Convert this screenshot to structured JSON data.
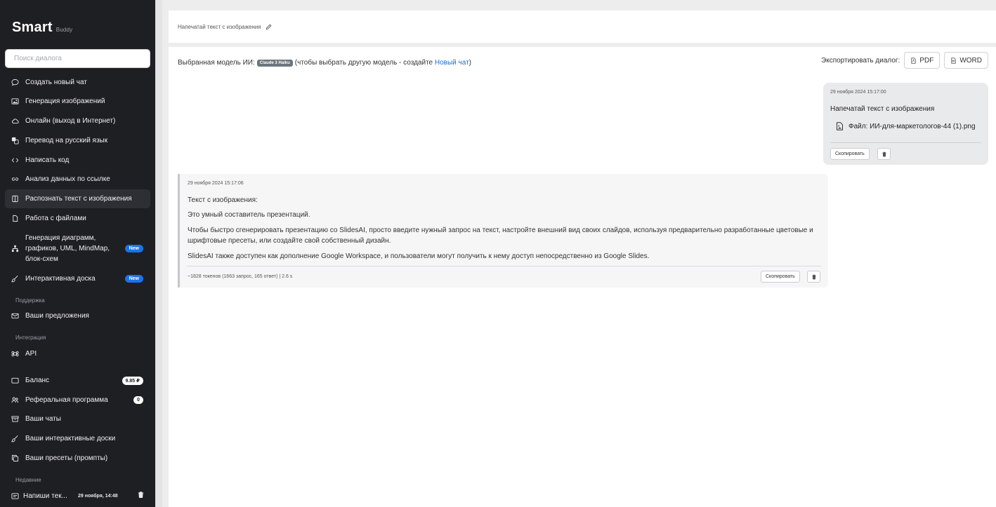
{
  "sidebar": {
    "brand": "Smart",
    "brand_sub": "Buddy",
    "search_placeholder": "Поиск диалога",
    "items": [
      {
        "label": "Создать новый чат",
        "icon": "chat-icon"
      },
      {
        "label": "Генерация изображений",
        "icon": "image-icon"
      },
      {
        "label": "Онлайн (выход в Интернет)",
        "icon": "cloud-icon"
      },
      {
        "label": "Перевод на русский язык",
        "icon": "translate-icon"
      },
      {
        "label": "Написать код",
        "icon": "code-icon"
      },
      {
        "label": "Анализ данных по ссылке",
        "icon": "link-icon"
      },
      {
        "label": "Распознать текст с изображения",
        "icon": "ocr-icon",
        "active": true
      },
      {
        "label": "Работа с файлами",
        "icon": "file-icon"
      },
      {
        "label": "Генерация диаграмм, графиков, UML, MindMap, блок-схем",
        "icon": "diagram-icon",
        "badge": "New"
      },
      {
        "label": "Интерактивная доска",
        "icon": "brush-icon",
        "badge": "New"
      }
    ],
    "support_label": "Поддержка",
    "support_item": "Ваши предложения",
    "integration_label": "Интеграция",
    "integration_item": "API",
    "account_items": [
      {
        "label": "Баланс",
        "badge": "9.85 ₽"
      },
      {
        "label": "Реферальная программа",
        "badge": "0"
      },
      {
        "label": "Ваши чаты"
      },
      {
        "label": "Ваши интерактивные доски"
      },
      {
        "label": "Ваши пресеты (промпты)"
      }
    ],
    "recent_label": "Недавние",
    "recent": [
      {
        "title": "Напиши тек...",
        "date": "29 ноября, 14:48"
      }
    ]
  },
  "header": {
    "title": "Напечатай текст с изображения"
  },
  "main": {
    "model_prefix": "Выбранная модель ИИ:",
    "model_name": "Claude 3 Haiku",
    "model_hint_start": "(чтобы выбрать другую модель - создайте",
    "model_hint_link": "Новый чат",
    "model_hint_end": ")",
    "export_label": "Экспортировать диалог:",
    "export_pdf": "PDF",
    "export_word": "WORD"
  },
  "messages": {
    "user": {
      "timestamp": "29 ноября 2024 15:17:00",
      "text": "Напечатай текст с изображения",
      "file": "Файл: ИИ-для-маркетологов-44 (1).png",
      "copy_label": "Скопировать"
    },
    "assistant": {
      "timestamp": "29 ноября 2024 15:17:06",
      "p1": "Текст с изображения:",
      "p2": "Это умный составитель презентаций.",
      "p3": "Чтобы быстро сгенерировать презентацию со SlidesAI, просто введите нужный запрос на текст, настройте внешний вид своих слайдов, используя предварительно разработанные цветовые и шрифтовые пресеты, или создайте свой собственный дизайн.",
      "p4": "SlidesAI также доступен как дополнение Google Workspace, и пользователи могут получить к нему доступ непосредственно из Google Slides.",
      "meta": "~1828 токенов (1663 запрос, 165 ответ) | 2.6 s",
      "copy_label": "Скопировать"
    }
  },
  "colors": {
    "sidebar_bg": "#1e1f23",
    "accent_blue": "#1a73e8",
    "link": "#1a6fd0",
    "model_badge": "#6c757d"
  }
}
